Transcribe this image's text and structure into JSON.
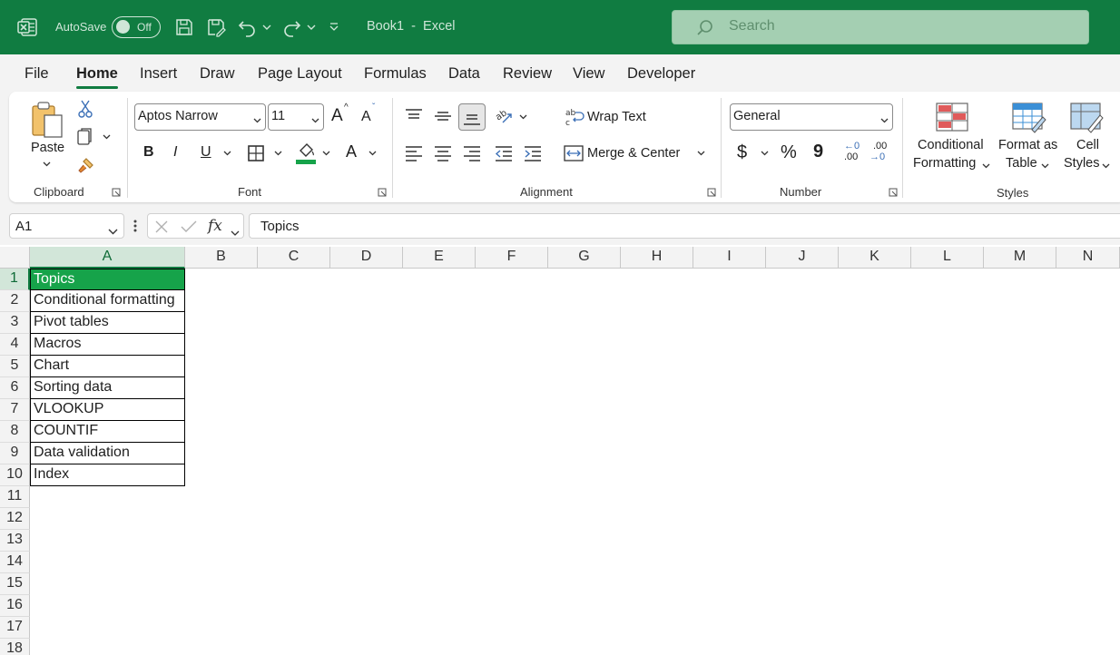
{
  "titlebar": {
    "autosave_label": "AutoSave",
    "autosave_state": "Off",
    "doc_title": "Book1  -  Excel",
    "search_placeholder": "Search",
    "brand_color": "#107c41"
  },
  "tabs": [
    {
      "label": "File"
    },
    {
      "label": "Home",
      "active": true
    },
    {
      "label": "Insert"
    },
    {
      "label": "Draw"
    },
    {
      "label": "Page Layout"
    },
    {
      "label": "Formulas"
    },
    {
      "label": "Data"
    },
    {
      "label": "Review"
    },
    {
      "label": "View"
    },
    {
      "label": "Developer"
    }
  ],
  "ribbon": {
    "clipboard": {
      "label": "Clipboard",
      "paste_label": "Paste"
    },
    "font": {
      "label": "Font",
      "font_name": "Aptos Narrow",
      "font_size": "11",
      "bold": "B",
      "italic": "I",
      "underline": "U",
      "grow": "A",
      "shrink": "A",
      "font_color": "A",
      "fill_color": "#16a34a"
    },
    "alignment": {
      "label": "Alignment",
      "wrap_text": "Wrap Text",
      "merge_center": "Merge & Center"
    },
    "number": {
      "label": "Number",
      "format": "General",
      "currency": "$",
      "percent": "%",
      "comma": "9",
      "inc_decimal_top": ".00",
      "dec_decimal_top": ".00",
      "inc_decimal_bottom": ".00",
      "dec_decimal_bottom": ".0"
    },
    "styles": {
      "label": "Styles",
      "conditional_line1": "Conditional",
      "conditional_line2": "Formatting",
      "format_table_line1": "Format as",
      "format_table_line2": "Table",
      "cell_styles_line1": "Cell",
      "cell_styles_line2": "Styles"
    }
  },
  "formula_bar": {
    "name_box": "A1",
    "fx": "fx",
    "content": "Topics"
  },
  "grid": {
    "columns": [
      "A",
      "B",
      "C",
      "D",
      "E",
      "F",
      "G",
      "H",
      "I",
      "J",
      "K",
      "L",
      "M",
      "N"
    ],
    "rows": [
      "1",
      "2",
      "3",
      "4",
      "5",
      "6",
      "7",
      "8",
      "9",
      "10",
      "11",
      "12",
      "13",
      "14",
      "15",
      "16",
      "17",
      "18"
    ],
    "column_a": [
      "Topics",
      "Conditional formatting",
      "Pivot tables",
      "Macros",
      "Chart",
      "Sorting data",
      "VLOOKUP",
      "COUNTIF",
      "Data validation",
      "Index"
    ],
    "header_fill": "#16a34a"
  }
}
